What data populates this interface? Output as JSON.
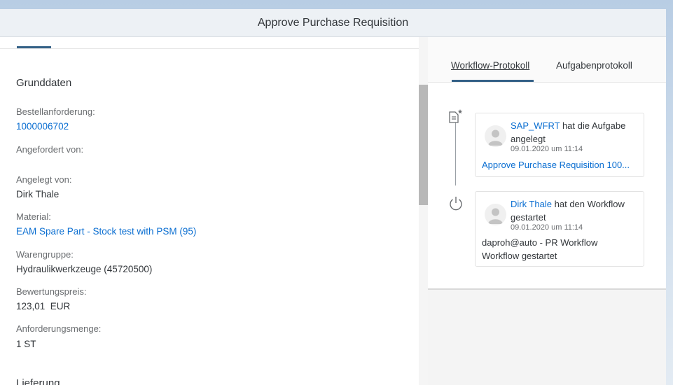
{
  "header": {
    "title": "Approve Purchase Requisition"
  },
  "main": {
    "section_grunddaten": "Grunddaten",
    "fields": [
      {
        "label": "Bestellanforderung:",
        "value": "1000006702"
      },
      {
        "label": "Angefordert von:",
        "value": ""
      },
      {
        "label": "Angelegt von:",
        "value": "Dirk Thale"
      },
      {
        "label": "Material:",
        "value": "EAM Spare Part - Stock test with PSM (95)"
      },
      {
        "label": "Warengruppe:",
        "value": "Hydraulikwerkzeuge (45720500)"
      },
      {
        "label": "Bewertungspreis:",
        "value": "123,01  EUR"
      },
      {
        "label": "Anforderungsmenge:",
        "value": "1 ST"
      }
    ],
    "section_lieferung": "Lieferung"
  },
  "side": {
    "tabs": [
      {
        "label": "Workflow-Protokoll",
        "active": true
      },
      {
        "label": "Aufgabenprotokoll",
        "active": false
      }
    ],
    "entries": [
      {
        "icon": "task-created-icon",
        "user": "SAP_WFRT",
        "action_1": "hat die Aufgabe",
        "action_2": "angelegt",
        "date": "09.01.2020 um 11:14",
        "detail_1": "Approve Purchase Requisition 100...",
        "detail_2": ""
      },
      {
        "icon": "power-icon",
        "user": "Dirk Thale",
        "action_1": "hat den Workflow",
        "action_2": "gestartet",
        "date": "09.01.2020 um 11:14",
        "detail_1": "daproh@auto - PR Workflow",
        "detail_2": "Workflow gestartet"
      }
    ]
  },
  "colors": {
    "link": "#0a6ed1",
    "accent": "#346187",
    "header_bg": "#edf1f5"
  }
}
